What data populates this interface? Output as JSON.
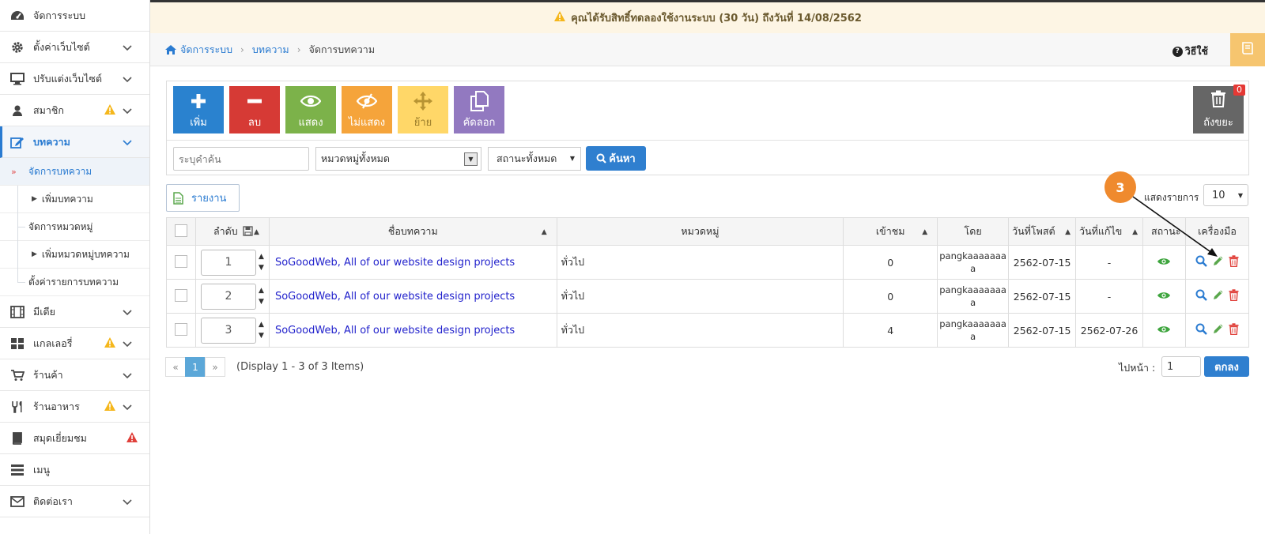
{
  "banner": {
    "text": "คุณได้รับสิทธิ์ทดลองใช้งานระบบ (30 วัน) ถึงวันที่ 14/08/2562"
  },
  "sidebar": {
    "items": [
      {
        "label": "จัดการระบบ",
        "icon": "dashboard-icon"
      },
      {
        "label": "ตั้งค่าเว็บไซต์",
        "icon": "gear-icon"
      },
      {
        "label": "ปรับแต่งเว็บไซต์",
        "icon": "monitor-icon"
      },
      {
        "label": "สมาชิก",
        "icon": "user-icon"
      },
      {
        "label": "บทความ",
        "icon": "edit-icon"
      },
      {
        "label": "มีเดีย",
        "icon": "film-icon"
      },
      {
        "label": "แกลเลอรี่",
        "icon": "grid-icon"
      },
      {
        "label": "ร้านค้า",
        "icon": "cart-icon"
      },
      {
        "label": "ร้านอาหาร",
        "icon": "utensils-icon"
      },
      {
        "label": "สมุดเยี่ยมชม",
        "icon": "book-icon"
      },
      {
        "label": "เมนู",
        "icon": "menu-icon"
      },
      {
        "label": "ติดต่อเรา",
        "icon": "envelope-icon"
      }
    ],
    "sub": {
      "manage": "จัดการบทความ",
      "add": "เพิ่มบทความ",
      "manage_cat": "จัดการหมวดหมู่",
      "add_cat": "เพิ่มหมวดหมู่บทความ",
      "settings": "ตั้งค่ารายการบทความ"
    }
  },
  "breadcrumb": [
    "จัดการระบบ",
    "บทความ",
    "จัดการบทความ"
  ],
  "help_label": "วิธีใช้",
  "toolbar": {
    "buttons": [
      {
        "label": "เพิ่ม",
        "color": "#2a82cf"
      },
      {
        "label": "ลบ",
        "color": "#d63a35"
      },
      {
        "label": "แสดง",
        "color": "#7cb24a"
      },
      {
        "label": "ไม่แสดง",
        "color": "#f5a43b"
      },
      {
        "label": "ย้าย",
        "color": "#ffd768"
      },
      {
        "label": "คัดลอก",
        "color": "#9279c0"
      }
    ],
    "trash_label": "ถังขยะ",
    "trash_count": "0"
  },
  "filters": {
    "search_placeholder": "ระบุคำค้น",
    "category": "หมวดหมู่ทั้งหมด",
    "status": "สถานะทั้งหมด",
    "search_button": "ค้นหา"
  },
  "report_label": "รายงาน",
  "perpage": {
    "label": "แสดงรายการ",
    "value": "10"
  },
  "step_marker": "3",
  "table": {
    "headers": [
      "ลำดับ",
      "ชื่อบทความ",
      "หมวดหมู่",
      "เข้าชม",
      "โดย",
      "วันที่โพสต์",
      "วันที่แก้ไข",
      "สถานะ",
      "เครื่องมือ"
    ],
    "rows": [
      {
        "order": "1",
        "title": "SoGoodWeb, All of our website design projects",
        "category": "ทั่วไป",
        "views": "0",
        "by_a": "pangkaaaaaaa",
        "by_b": "a",
        "posted": "2562-07-15",
        "edited": "-"
      },
      {
        "order": "2",
        "title": "SoGoodWeb, All of our website design projects",
        "category": "ทั่วไป",
        "views": "0",
        "by_a": "pangkaaaaaaa",
        "by_b": "a",
        "posted": "2562-07-15",
        "edited": "-"
      },
      {
        "order": "3",
        "title": "SoGoodWeb, All of our website design projects",
        "category": "ทั่วไป",
        "views": "4",
        "by_a": "pangkaaaaaaa",
        "by_b": "a",
        "posted": "2562-07-15",
        "edited": "2562-07-26"
      }
    ]
  },
  "pagination": {
    "prev": "«",
    "current": "1",
    "next": "»",
    "info": "(Display 1 - 3 of 3 Items)"
  },
  "goto": {
    "label": "ไปหน้า :",
    "value": "1",
    "button": "ตกลง"
  }
}
